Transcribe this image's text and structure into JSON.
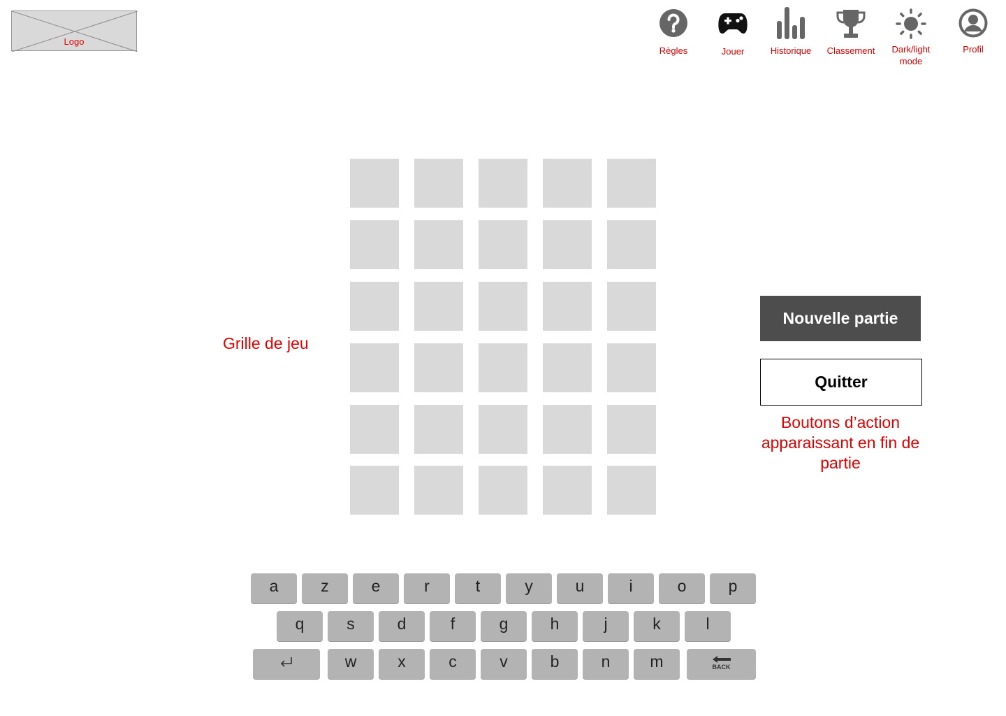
{
  "header": {
    "logo_label": "Logo",
    "nav": [
      {
        "label": "Règles",
        "icon": "help-icon"
      },
      {
        "label": "Jouer",
        "icon": "gamepad-icon"
      },
      {
        "label": "Historique",
        "icon": "bar-chart-icon"
      },
      {
        "label": "Classement",
        "icon": "trophy-icon"
      },
      {
        "label": "Dark/light mode",
        "icon": "sun-icon"
      },
      {
        "label": "Profil",
        "icon": "user-icon"
      }
    ]
  },
  "grid": {
    "label": "Grille de jeu",
    "rows": 6,
    "cols": 5
  },
  "actions": {
    "new_game": "Nouvelle partie",
    "quit": "Quitter",
    "note": "Boutons d’action apparaissant en fin de partie"
  },
  "keyboard": {
    "row1": [
      "a",
      "z",
      "e",
      "r",
      "t",
      "y",
      "u",
      "i",
      "o",
      "p"
    ],
    "row2": [
      "q",
      "s",
      "d",
      "f",
      "g",
      "h",
      "j",
      "k",
      "l"
    ],
    "row3": [
      "w",
      "x",
      "c",
      "v",
      "b",
      "n",
      "m"
    ],
    "enter_icon": "enter-icon",
    "back_label": "BACK"
  },
  "colors": {
    "annotation": "#e00000",
    "tile": "#d9d9d9",
    "key": "#b3b3b3",
    "primary_button": "#4d4d4d"
  }
}
